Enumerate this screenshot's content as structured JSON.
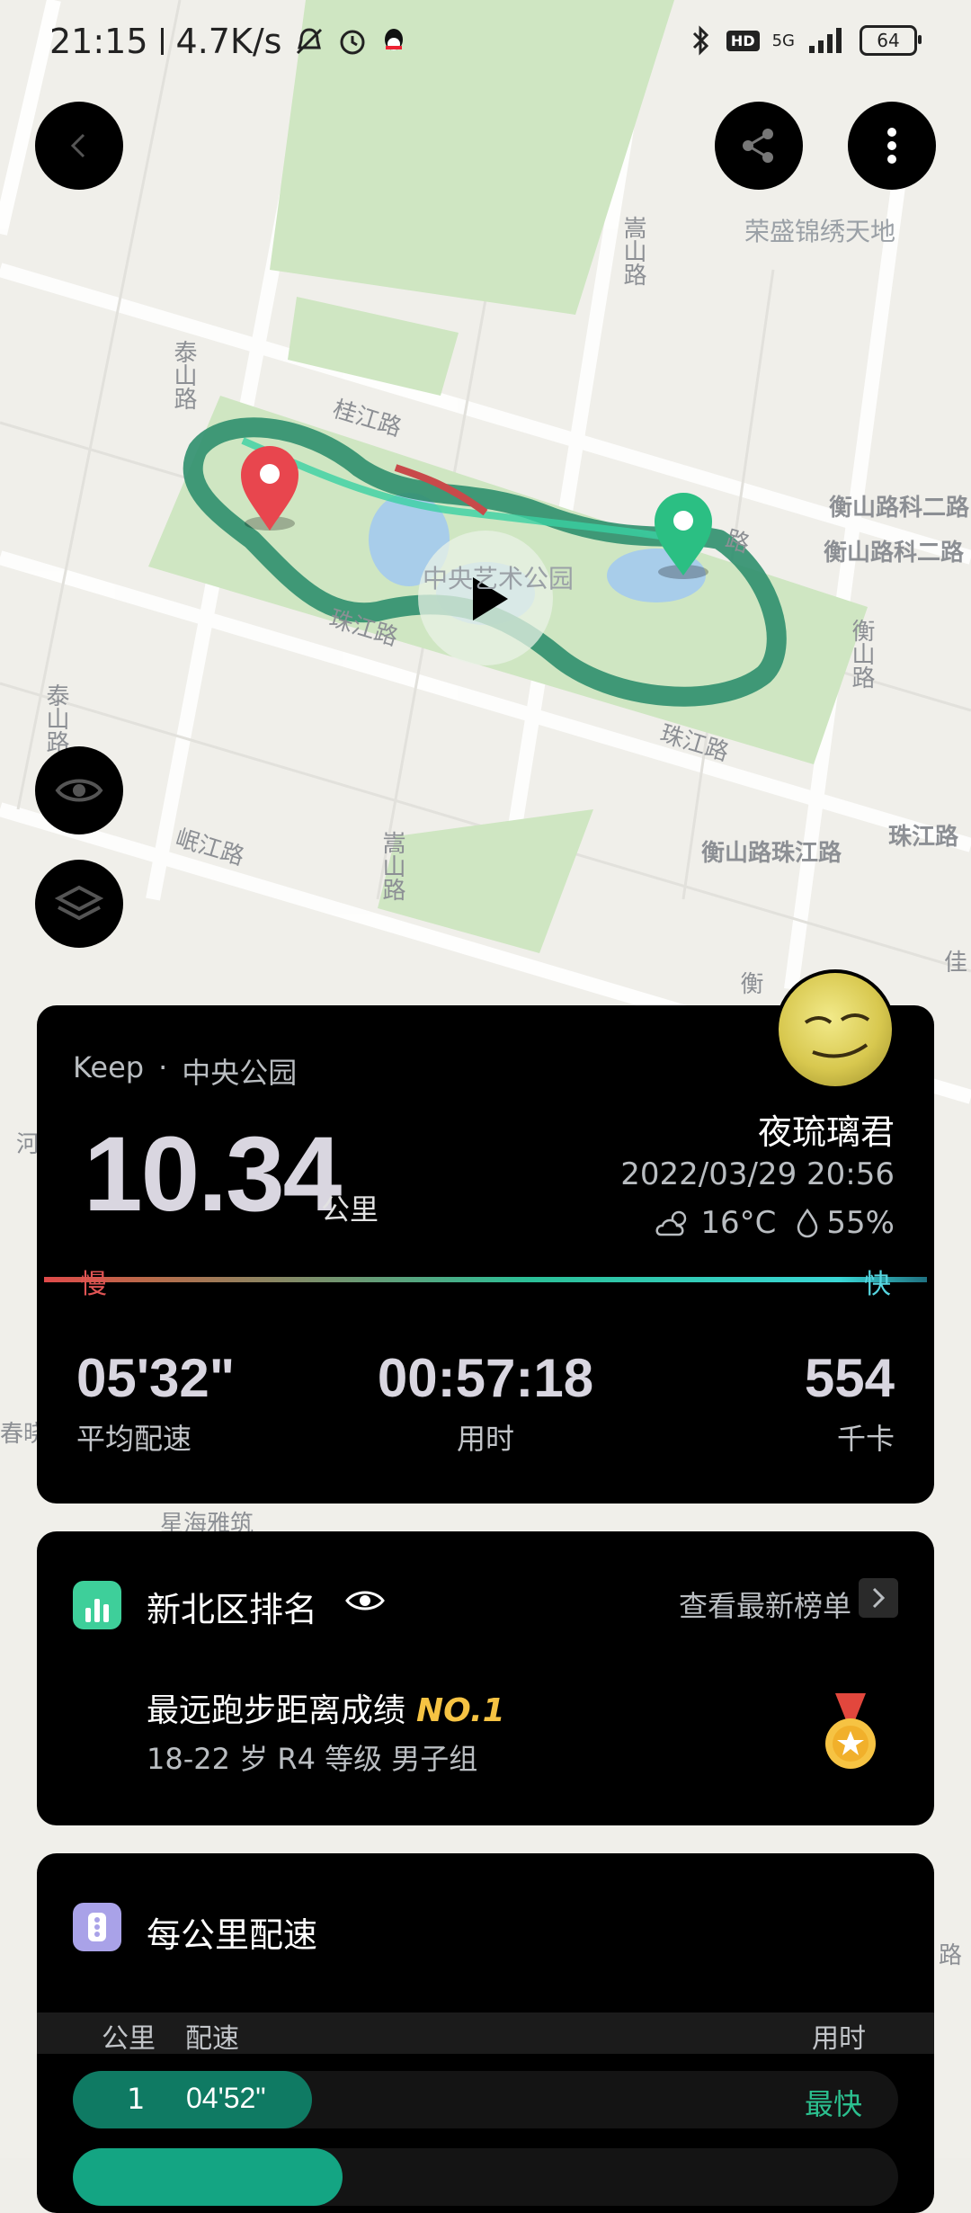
{
  "status_bar": {
    "time": "21:15",
    "speed": "4.7K/s",
    "network": "5G",
    "hd": "HD",
    "battery": "64"
  },
  "map": {
    "labels": [
      "桂江路",
      "泰山路",
      "泰山路",
      "嵩山路",
      "嵩山路",
      "珠江路",
      "珠江路",
      "珠江路",
      "衡山路",
      "衡山路科二路",
      "衡山路科二路",
      "衡山路珠江路",
      "岷江路",
      "中央艺术公园",
      "荣盛锦绣天地",
      "星海雅筑",
      "春晓",
      "衡",
      "路",
      "河",
      "佳",
      "路"
    ]
  },
  "summary": {
    "source_app": "Keep",
    "source_sep": "·",
    "source_place": "中央公园",
    "distance": "10.34",
    "distance_unit": "公里",
    "username": "夜琉璃君",
    "datetime": "2022/03/29 20:56",
    "temperature": "16°C",
    "humidity": "55%",
    "slow_label": "慢",
    "fast_label": "快",
    "stats": {
      "avg_pace": "05'32\"",
      "avg_pace_label": "平均配速",
      "duration": "00:57:18",
      "duration_label": "用时",
      "calories": "554",
      "calories_label": "千卡"
    }
  },
  "ranking": {
    "title": "新北区排名",
    "link": "查看最新榜单",
    "achievement": "最远跑步距离成绩",
    "rank": "NO.1",
    "group": "18-22 岁 R4 等级 男子组"
  },
  "pace": {
    "title": "每公里配速",
    "headers": {
      "km": "公里",
      "pace": "配速",
      "time": "用时"
    },
    "rows": [
      {
        "km": "1",
        "pace": "04'52\"",
        "tag": "最快",
        "fill_fraction": 0.29
      }
    ]
  },
  "colors": {
    "accent_green": "#2bc08f",
    "route": "#2f8f6e",
    "start_pin": "#e8464e",
    "end_pin": "#2bbf83",
    "gold": "#f6c343"
  },
  "icons": [
    "back-icon",
    "share-icon",
    "more-icon",
    "eye-icon",
    "layers-icon",
    "play-icon",
    "cloud-sun-icon",
    "droplet-icon",
    "bar-chart-icon",
    "chevron-right-icon",
    "medal-icon",
    "traffic-light-icon"
  ]
}
